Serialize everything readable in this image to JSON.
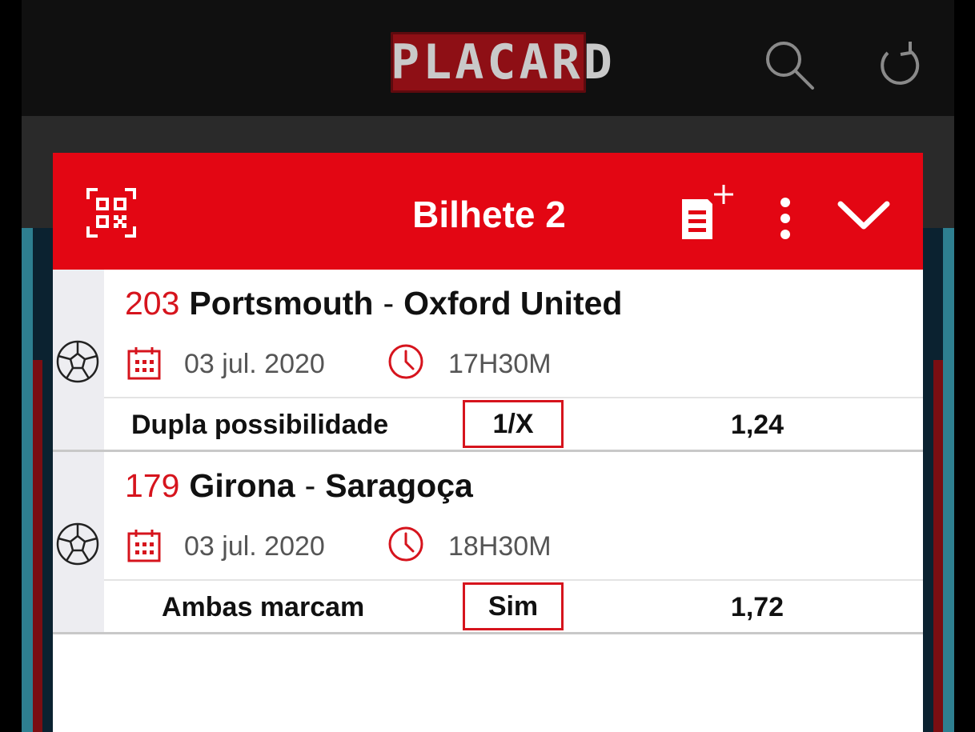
{
  "app": {
    "logo_text": "PLACARD"
  },
  "ticket": {
    "title": "Bilhete 2"
  },
  "selections": [
    {
      "number": "203",
      "home": "Portsmouth",
      "separator": "-",
      "away": "Oxford United",
      "date": "03 jul. 2020",
      "time": "17H30M",
      "market": "Dupla possibilidade",
      "pick": "1/X",
      "odd": "1,24"
    },
    {
      "number": "179",
      "home": "Girona",
      "separator": "-",
      "away": "Saragoça",
      "date": "03 jul. 2020",
      "time": "18H30M",
      "market": "Ambas marcam",
      "pick": "Sim",
      "odd": "1,72"
    }
  ],
  "icons": {
    "search": "search-icon",
    "refresh": "refresh-icon",
    "qr": "qr-code-icon",
    "new_ticket": "new-ticket-icon",
    "more": "more-vertical-icon",
    "collapse": "chevron-down-icon",
    "sport": "soccer-ball-icon",
    "date": "calendar-icon",
    "time": "clock-icon"
  },
  "colors": {
    "brand_red": "#e30613",
    "accent_red": "#d6141d"
  }
}
